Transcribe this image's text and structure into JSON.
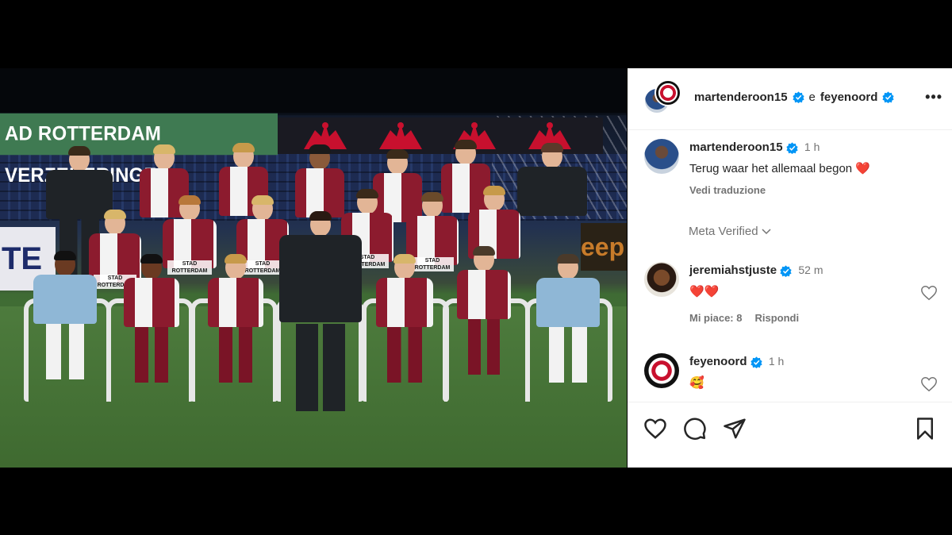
{
  "photo": {
    "banner_text": "AD ROTTERDAM VERZEKERINGEN",
    "board_left_text": "TE",
    "board_right_text": "eep",
    "sponsor_text": "STAD ROTTERDAM VERZEKERINGEN"
  },
  "post": {
    "author": "martenderoon15",
    "conjunction": "e",
    "collaborator": "feyenoord",
    "more_label": "•••"
  },
  "comments": [
    {
      "user": "martenderoon15",
      "time": "1 h",
      "text": "Terug waar het allemaal begon ❤️",
      "translate": "Vedi traduzione"
    },
    {
      "user": "jeremiahstjuste",
      "time": "52 m",
      "text": "❤️❤️",
      "likes": "Mi piace: 8",
      "reply": "Rispondi"
    },
    {
      "user": "feyenoord",
      "time": "1 h",
      "text": "🥰"
    }
  ],
  "meta_verified": "Meta Verified",
  "colors": {
    "verified_blue": "#0095f6",
    "text": "#262626",
    "muted": "#737373"
  },
  "icons": [
    "heart-icon",
    "comment-icon",
    "share-icon",
    "bookmark-icon",
    "verified-badge-icon",
    "more-icon",
    "chevron-down-icon"
  ]
}
